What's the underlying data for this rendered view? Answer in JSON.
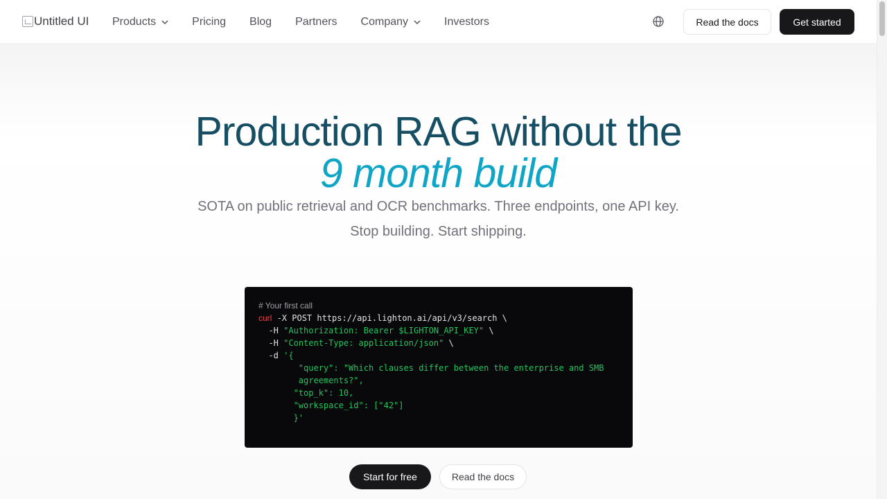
{
  "nav": {
    "logo_alt": "Untitled UI",
    "links": [
      {
        "label": "Products",
        "has_dropdown": true
      },
      {
        "label": "Pricing",
        "has_dropdown": false
      },
      {
        "label": "Blog",
        "has_dropdown": false
      },
      {
        "label": "Partners",
        "has_dropdown": false
      },
      {
        "label": "Company",
        "has_dropdown": true
      },
      {
        "label": "Investors",
        "has_dropdown": false
      }
    ],
    "language_icon": "globe-icon",
    "docs_button": "Read the docs",
    "cta_button": "Get started"
  },
  "hero": {
    "title_line1": "Production RAG without the",
    "title_line2": "9 month build",
    "subtitle_line1": "SOTA on public retrieval and OCR benchmarks. Three endpoints, one API key.",
    "subtitle_line2": "Stop building. Start shipping."
  },
  "code": {
    "comment": "# Your first call",
    "cmd": "curl",
    "line1_rest": "-X POST https://api.lighton.ai/api/v3/search \\",
    "h1_flag": "-H",
    "h1_value": "\"Authorization: Bearer $LIGHTON_API_KEY\"",
    "h1_tail": " \\",
    "h2_flag": "-H",
    "h2_value": "\"Content-Type: application/json\"",
    "h2_tail": " \\",
    "d_flag": "-d",
    "d_open": "'{",
    "query_line1": "\"query\": \"Which clauses differ between the enterprise and SMB",
    "query_line2": "agreements?\",",
    "topk_line": "\"top_k\": 10,",
    "workspace_line": "\"workspace_id\": [\"42\"]",
    "d_close": "}'"
  },
  "cta": {
    "primary": "Start for free",
    "secondary": "Read the docs"
  },
  "colors": {
    "title": "#164e63",
    "accent": "#0ea5c6",
    "dark_button": "#18181b",
    "code_bg": "#09090b",
    "code_string": "#22c55e",
    "code_cmd": "#ef4444"
  }
}
